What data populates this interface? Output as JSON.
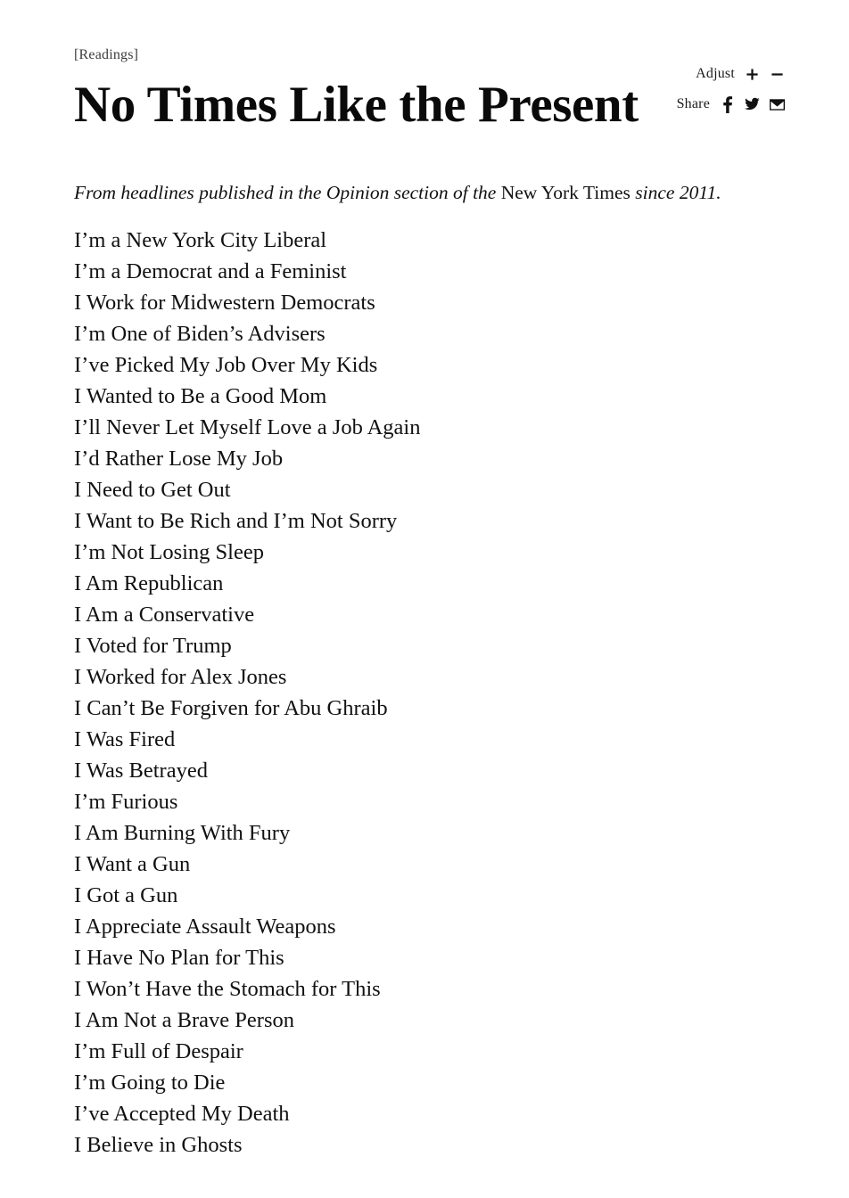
{
  "article": {
    "kicker": "[Readings]",
    "title": "No Times Like the Present",
    "standfirst": {
      "before": "From headlines published in the Opinion section of the ",
      "publication": "New York Times",
      "after": " since 2011."
    }
  },
  "utility": {
    "adjust_label": "Adjust",
    "increase_label": "+",
    "decrease_label": "−",
    "share_label": "Share",
    "share_targets": [
      "facebook-icon",
      "twitter-icon",
      "email-icon"
    ]
  },
  "headlines": [
    "I’m a New York City Liberal",
    "I’m a Democrat and a Feminist",
    "I Work for Midwestern Democrats",
    "I’m One of Biden’s Advisers",
    "I’ve Picked My Job Over My Kids",
    "I Wanted to Be a Good Mom",
    "I’ll Never Let Myself Love a Job Again",
    "I’d Rather Lose My Job",
    "I Need to Get Out",
    "I Want to Be Rich and I’m Not Sorry",
    "I’m Not Losing Sleep",
    "I Am Republican",
    "I Am a Conservative",
    "I Voted for Trump",
    "I Worked for Alex Jones",
    "I Can’t Be Forgiven for Abu Ghraib",
    "I Was Fired",
    "I Was Betrayed",
    "I’m Furious",
    "I Am Burning With Fury",
    "I Want a Gun",
    "I Got a Gun",
    "I Appreciate Assault Weapons",
    "I Have No Plan for This",
    "I Won’t Have the Stomach for This",
    "I Am Not a Brave Person",
    "I’m Full of Despair",
    "I’m Going to Die",
    "I’ve Accepted My Death",
    "I Believe in Ghosts"
  ],
  "colors": {
    "background": "#ffffff",
    "text": "#111111",
    "kicker": "#3d3d3d"
  }
}
